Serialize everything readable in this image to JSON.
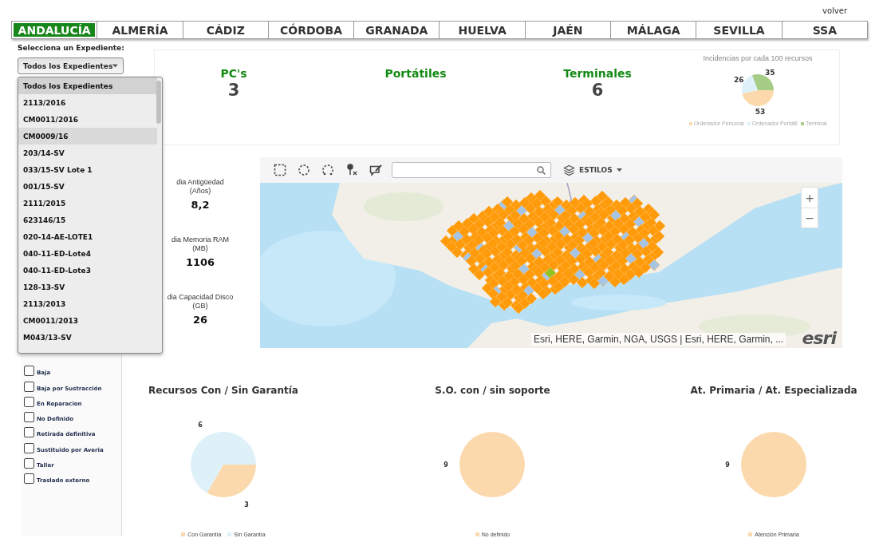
{
  "header": {
    "link": "volver"
  },
  "tabs": [
    {
      "label": "ANDALUCÍA",
      "selected": true
    },
    {
      "label": "ALMERÍA",
      "selected": false
    },
    {
      "label": "CÁDIZ",
      "selected": false
    },
    {
      "label": "CÓRDOBA",
      "selected": false
    },
    {
      "label": "GRANADA",
      "selected": false
    },
    {
      "label": "HUELVA",
      "selected": false
    },
    {
      "label": "JAÉN",
      "selected": false
    },
    {
      "label": "MÁLAGA",
      "selected": false
    },
    {
      "label": "SEVILLA",
      "selected": false
    },
    {
      "label": "SSA",
      "selected": false
    }
  ],
  "filter": {
    "label": "Selecciona un Expediente:",
    "value": "Todos los Expedientes",
    "expanded": true,
    "options": [
      {
        "label": "Todos los Expedientes",
        "selected": true,
        "hovered": false
      },
      {
        "label": "2113/2016",
        "selected": false,
        "hovered": false
      },
      {
        "label": "CM0011/2016",
        "selected": false,
        "hovered": false
      },
      {
        "label": "CM0009/16",
        "selected": false,
        "hovered": true
      },
      {
        "label": "203/14-SV",
        "selected": false,
        "hovered": false
      },
      {
        "label": "033/15-SV Lote 1",
        "selected": false,
        "hovered": false
      },
      {
        "label": "001/15-SV",
        "selected": false,
        "hovered": false
      },
      {
        "label": "2111/2015",
        "selected": false,
        "hovered": false
      },
      {
        "label": "623146/15",
        "selected": false,
        "hovered": false
      },
      {
        "label": "020-14-AE-LOTE1",
        "selected": false,
        "hovered": false
      },
      {
        "label": "040-11-ED-Lote4",
        "selected": false,
        "hovered": false
      },
      {
        "label": "040-11-ED-Lote3",
        "selected": false,
        "hovered": false
      },
      {
        "label": "128-13-SV",
        "selected": false,
        "hovered": false
      },
      {
        "label": "2113/2013",
        "selected": false,
        "hovered": false
      },
      {
        "label": "CM0011/2013",
        "selected": false,
        "hovered": false
      },
      {
        "label": "M043/13-SV",
        "selected": false,
        "hovered": false
      }
    ]
  },
  "status_filters": [
    {
      "label": "Baja",
      "checked": false
    },
    {
      "label": "Baja por Sustracción",
      "checked": false
    },
    {
      "label": "En Reparacion",
      "checked": false
    },
    {
      "label": "No Definido",
      "checked": false
    },
    {
      "label": "Retirada definitiva",
      "checked": false
    },
    {
      "label": "Sustituido por Averia",
      "checked": false
    },
    {
      "label": "Taller",
      "checked": false
    },
    {
      "label": "Traslado externo",
      "checked": false
    }
  ],
  "kpi_panel": {
    "kpis": [
      {
        "title": "PC's",
        "value": "3"
      },
      {
        "title": "Portátiles"
      },
      {
        "title": "Terminales",
        "value": "6"
      }
    ],
    "incidents_chart": {
      "chart_data": {
        "type": "pie",
        "title": "Incidencias por cada 100 recursos",
        "categories": [
          "Ordenador Personal",
          "Ordenador Portatil",
          "Terminal"
        ],
        "values": [
          53,
          26,
          35
        ],
        "colors": [
          "#fbd9ad",
          "#def1f8",
          "#a6cc86"
        ],
        "data_labels": true,
        "legend": "bottom"
      }
    }
  },
  "stats": [
    {
      "label": "dia Antigüedad",
      "unit": "(Años)",
      "value": "8,2"
    },
    {
      "label": "dia Memoria RAM",
      "unit": "(MB)",
      "value": "1106"
    },
    {
      "label": "dia Capacidad Disco",
      "unit": "(GB)",
      "value": "26"
    }
  ],
  "map": {
    "styles_button": "ESTILOS",
    "zoom_in": "+",
    "zoom_out": "−",
    "attribution": "Esri, HERE, Garmin, NGA, USGS | Esri, HERE, Garmin, ...",
    "logo": "esri"
  },
  "charts": [
    {
      "chart_data": {
        "type": "pie",
        "title": "Recursos Con / Sin Garantía",
        "categories": [
          "Con Garantía",
          "Sin Garantía"
        ],
        "values": [
          3,
          6
        ],
        "colors": [
          "#fbd9ad",
          "#def1f8"
        ],
        "data_labels": true,
        "legend": "bottom"
      }
    },
    {
      "chart_data": {
        "type": "pie",
        "title": "S.O. con / sin soporte",
        "categories": [
          "No definido"
        ],
        "values": [
          9
        ],
        "colors": [
          "#fbd9ad"
        ],
        "data_labels": true,
        "legend": "bottom"
      }
    },
    {
      "chart_data": {
        "type": "pie",
        "title": "At. Primaria / At. Especializada",
        "categories": [
          "Atención Primaria"
        ],
        "values": [
          9
        ],
        "colors": [
          "#fbd9ad"
        ],
        "data_labels": true,
        "legend": "bottom"
      }
    }
  ]
}
